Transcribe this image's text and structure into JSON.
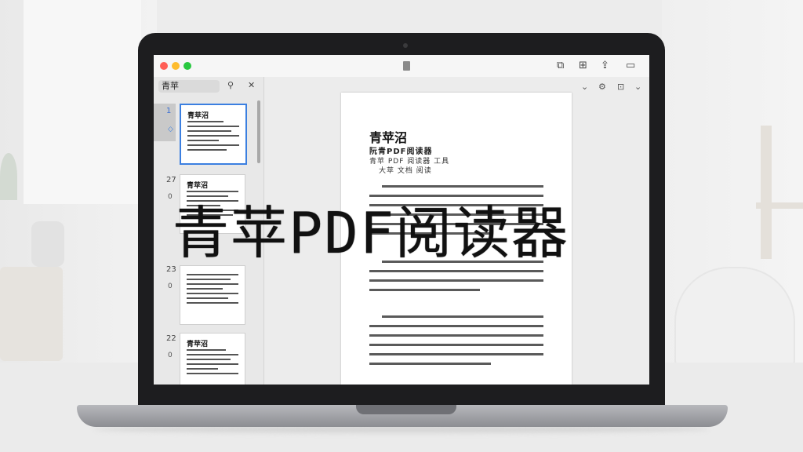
{
  "overlay_title": "青苹PDF阅读器",
  "window": {
    "traffic_lights": {
      "close": "#ff5f57",
      "minimize": "#febc2e",
      "zoom": "#28c840"
    },
    "toolbar_icons": [
      "sidebar-icon",
      "bookmark-icon",
      "share-icon",
      "window-icon"
    ]
  },
  "sidebar": {
    "search_value": "青苹",
    "thumbnails": [
      {
        "number": "1",
        "sub": "◇",
        "title": "青苹沼",
        "active": true
      },
      {
        "number": "27",
        "sub": "0",
        "title": "青苹沼",
        "active": false
      },
      {
        "number": "23",
        "sub": "0",
        "title": "",
        "active": false
      },
      {
        "number": "22",
        "sub": "0",
        "title": "青苹沼",
        "active": false
      }
    ]
  },
  "document": {
    "title": "青苹沼",
    "subtitle": "阮青PDF阅读器",
    "author_line": "青苹 PDF 阅读器 工具",
    "date_line": "大苹 文档 阅读"
  },
  "accent": "#3b7fe0"
}
